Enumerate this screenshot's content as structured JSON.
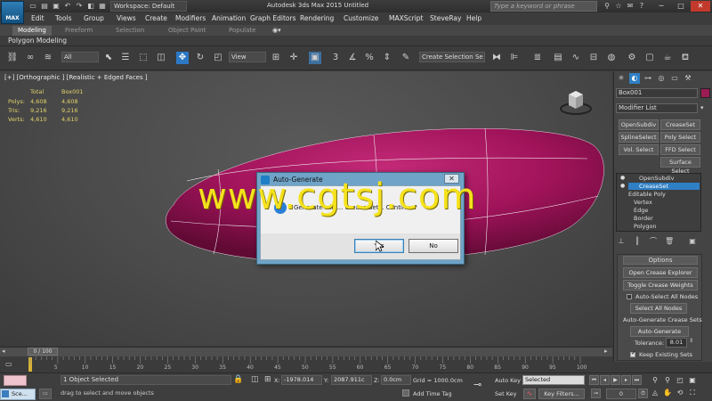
{
  "titlebar": {
    "logo": "MAX",
    "workspace": "Workspace: Default",
    "app_title": "Autodesk 3ds Max  2015    Untitled",
    "search_placeholder": "Type a keyword or phrase"
  },
  "menu": [
    "Edit",
    "Tools",
    "Group",
    "Views",
    "Create",
    "Modifiers",
    "Animation",
    "Graph Editors",
    "Rendering",
    "Customize",
    "MAXScript",
    "SteveRay",
    "Help"
  ],
  "ribbon": {
    "tabs": [
      "Modeling",
      "Freeform",
      "Selection",
      "Object Paint",
      "Populate"
    ],
    "subpanel": "Polygon Modeling"
  },
  "toolbar": {
    "filter_value": "All",
    "refcoord_value": "View",
    "selection_set_value": "Create Selection Se"
  },
  "viewport": {
    "label": "[+] [Orthographic ] [Realistic + Edged Faces ]",
    "stats": {
      "header_total": "Total",
      "header_obj": "Box001",
      "rows": [
        {
          "label": "Polys:",
          "total": "4,608",
          "obj": "4,608"
        },
        {
          "label": "Tris:",
          "total": "9,216",
          "obj": "9,216"
        },
        {
          "label": "Verts:",
          "total": "4,610",
          "obj": "4,610"
        }
      ]
    },
    "object_color": "#a0135a",
    "watermark": "www.cgtsj.com"
  },
  "dialog": {
    "title": "Auto-Generate",
    "message": "Generate will ... Crease Sets. Continue?",
    "yes": "Yes",
    "no": "No"
  },
  "command_panel": {
    "object_name": "Box001",
    "modifier_list": "Modifier List",
    "mod_buttons": [
      [
        "OpenSubdiv",
        "CreaseSet"
      ],
      [
        "SplineSelect",
        "Poly Select"
      ],
      [
        "Vol. Select",
        "FFD Select"
      ],
      [
        "",
        "Surface Select"
      ]
    ],
    "stack": [
      {
        "label": "OpenSubdiv",
        "selected": false
      },
      {
        "label": "CreaseSet",
        "selected": true
      },
      {
        "label": "Editable Poly",
        "selected": false
      },
      {
        "label": "Vertex",
        "selected": false
      },
      {
        "label": "Edge",
        "selected": false
      },
      {
        "label": "Border",
        "selected": false
      },
      {
        "label": "Polygon",
        "selected": false
      }
    ],
    "options_header": "Options",
    "open_crease_explorer": "Open Crease Explorer",
    "toggle_crease_weights": "Toggle Crease Weights",
    "auto_select_all_nodes": "Auto-Select All Nodes",
    "select_all_nodes": "Select All Nodes",
    "auto_generate_section": "Auto-Generate Crease Sets",
    "auto_generate": "Auto-Generate",
    "tolerance_label": "Tolerance:",
    "tolerance_value": "8.01",
    "keep_existing": "Keep Existing Sets"
  },
  "timeline": {
    "slider": "0 / 100",
    "ticks": [
      "5",
      "10",
      "15",
      "20",
      "25",
      "30",
      "35",
      "40",
      "45",
      "50",
      "55",
      "60",
      "65",
      "70",
      "75",
      "80",
      "85",
      "90",
      "95",
      "100"
    ]
  },
  "status": {
    "selection": "1 Object Selected",
    "prompt": "drag to select and move objects",
    "script_label": "Sce...",
    "x_label": "X:",
    "x": "-1978.014",
    "y_label": "Y:",
    "y": "2087.911c",
    "z_label": "Z:",
    "z": "0.0cm",
    "grid": "Grid = 1000.0cm",
    "add_time_tag": "Add Time Tag",
    "auto_key": "Auto Key",
    "set_key": "Set Key",
    "selected_drop": "Selected",
    "key_filters": "Key Filters...",
    "frame": "0"
  }
}
